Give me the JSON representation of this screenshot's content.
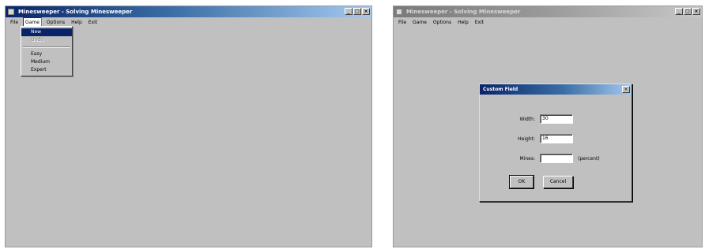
{
  "app_title": "Minesweeper - Solving Minesweeper",
  "window_controls": [
    "_",
    "□",
    "×"
  ],
  "menubar": [
    "File",
    "Game",
    "Options",
    "Help",
    "Exit"
  ],
  "game_menu": {
    "items": [
      {
        "label": "New",
        "state": "selected"
      },
      {
        "label": "Undo",
        "state": "disabled"
      },
      {
        "label": "Easy",
        "state": "normal"
      },
      {
        "label": "Medium",
        "state": "normal"
      },
      {
        "label": "Expert",
        "state": "normal"
      }
    ]
  },
  "dialog": {
    "title": "Custom Field",
    "close": "×",
    "fields": [
      {
        "label": "Width:",
        "value": "30"
      },
      {
        "label": "Height:",
        "value": "16"
      },
      {
        "label": "Mines:",
        "value": ""
      }
    ],
    "mines_note": "(percent)",
    "ok_label": "OK",
    "cancel_label": "Cancel"
  }
}
